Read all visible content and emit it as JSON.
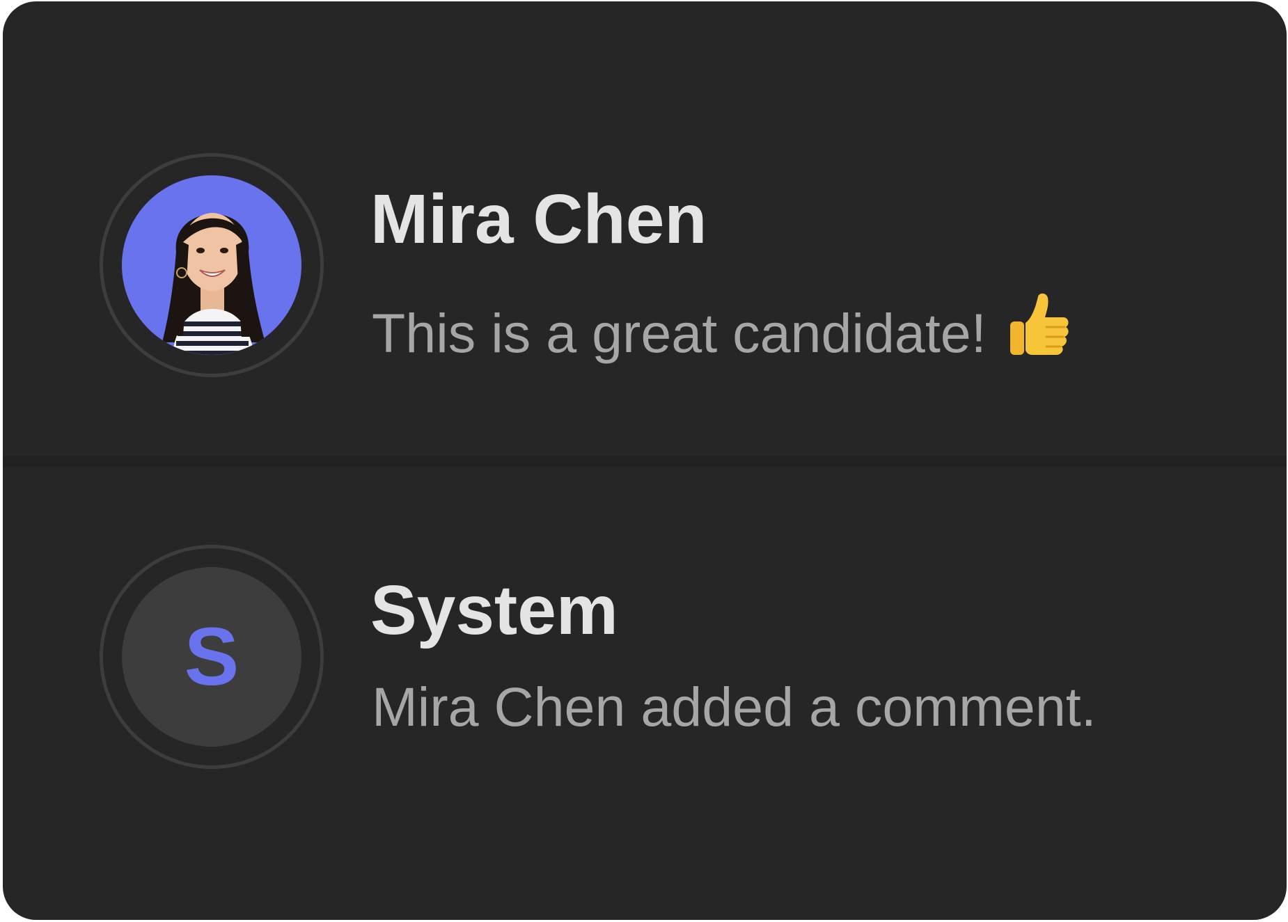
{
  "feed": {
    "entries": [
      {
        "author": "Mira Chen",
        "avatar": {
          "type": "photo",
          "background": "#6a73ee"
        },
        "message": "This is a great candidate!",
        "emoji_icon": "thumbs-up-icon"
      },
      {
        "author": "System",
        "avatar": {
          "type": "initial",
          "initial": "S",
          "background": "#3d3d3d",
          "color": "#6a73ee"
        },
        "message": "Mira Chen added a comment."
      }
    ]
  },
  "colors": {
    "card_background": "#262626",
    "name_text": "#e4e4e4",
    "message_text": "#a6a6a6",
    "accent": "#6a73ee"
  }
}
